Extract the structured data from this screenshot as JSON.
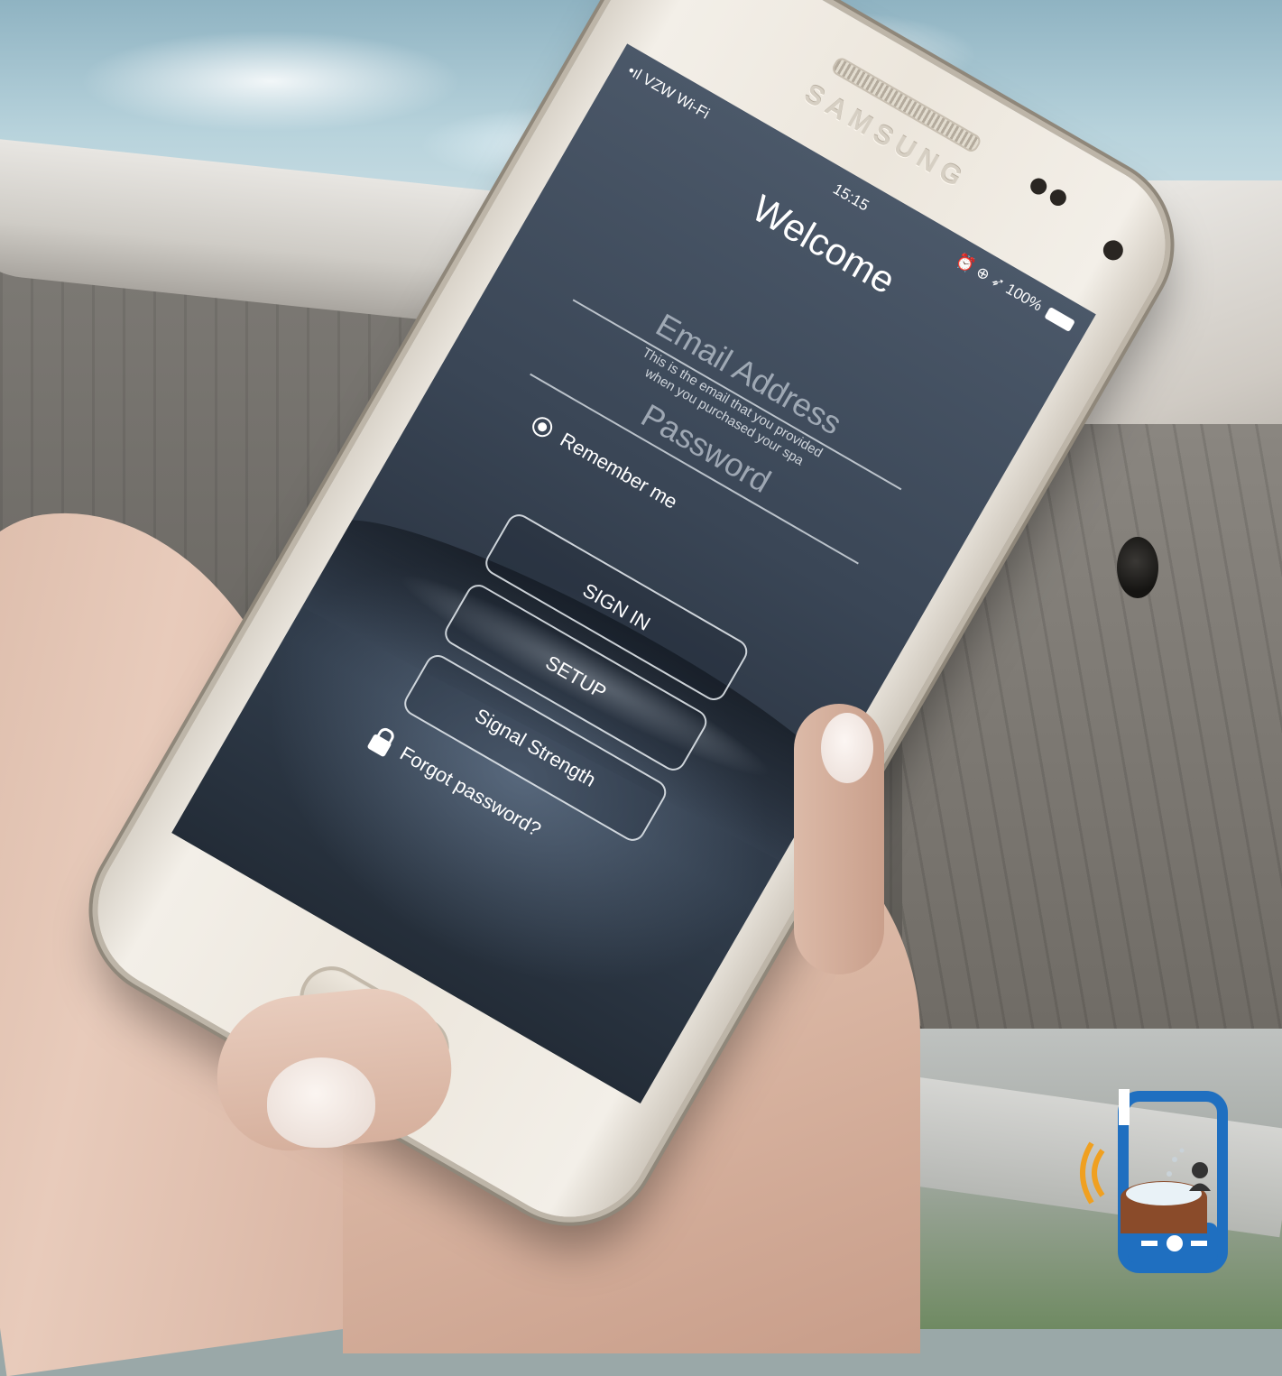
{
  "status_bar": {
    "carrier": "•ıl VZW Wi-Fi",
    "time": "15:15",
    "right": "⏰ ⊕ ➶ 100%"
  },
  "phone": {
    "brand": "SAMSUNG"
  },
  "login": {
    "title": "Welcome",
    "email_placeholder": "Email Address",
    "email_hint_line1": "This is the email that you provided",
    "email_hint_line2": "when you purchased your spa",
    "password_placeholder": "Password",
    "remember_label": "Remember me",
    "remember_checked": true,
    "sign_in_label": "SIGN IN",
    "setup_label": "SETUP",
    "signal_label": "Signal Strength",
    "forgot_label": "Forgot password?"
  },
  "colors": {
    "screen_top": "#4b5869",
    "screen_bottom": "#232c37",
    "logo_blue": "#1f6fc0",
    "logo_orange": "#f0a020",
    "logo_wood": "#8a4b2a"
  }
}
